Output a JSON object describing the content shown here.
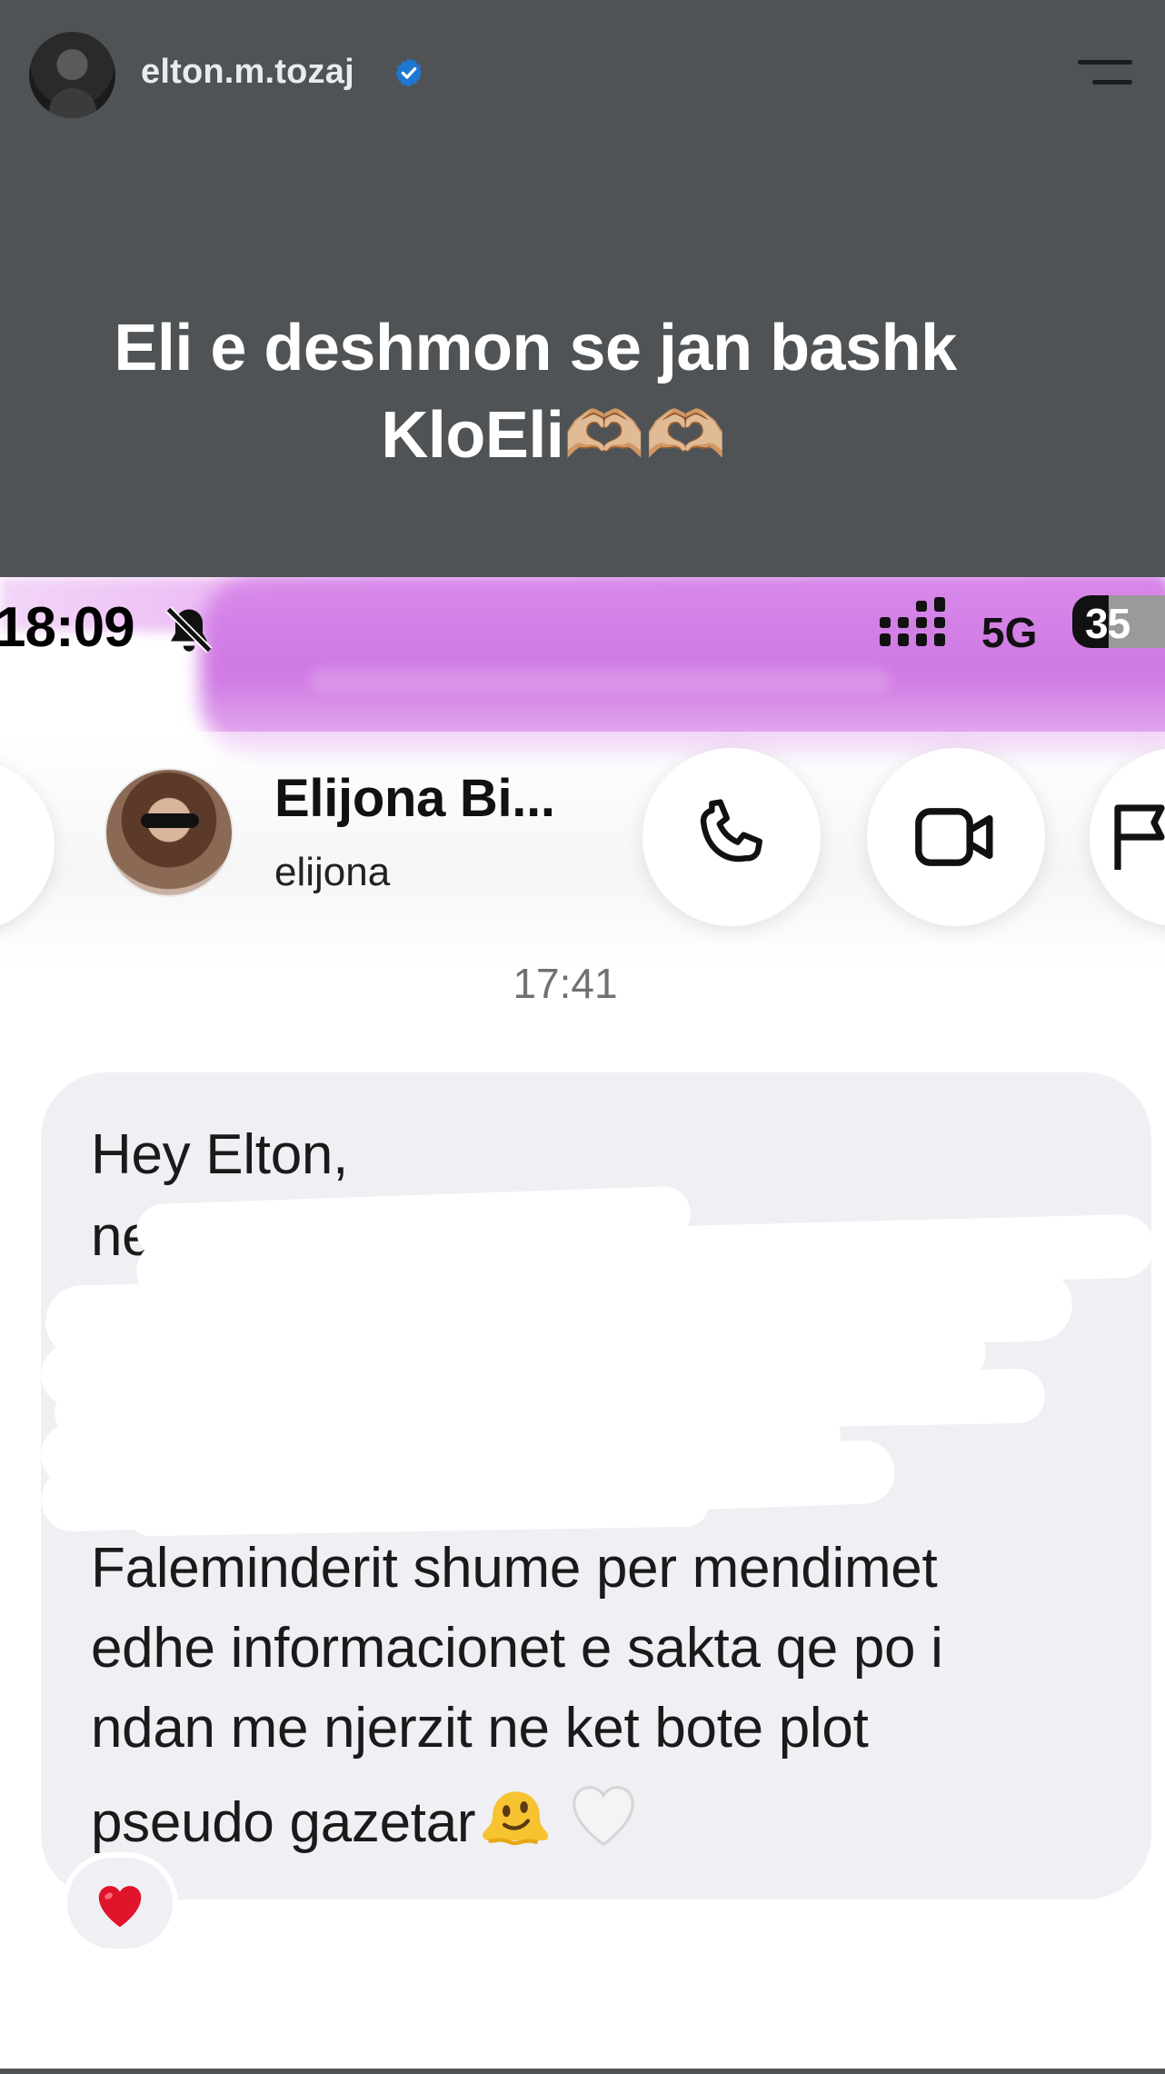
{
  "story": {
    "username": "elton.m.tozaj",
    "caption_line1": "Eli e deshmon se jan bashk",
    "caption_line2": "KloEli🫶🏼🫶🏼"
  },
  "screenshot": {
    "status_bar": {
      "time": "18:09",
      "network": "5G",
      "battery": "35"
    },
    "chat_header": {
      "name": "Elijona Bi...",
      "handle": "elijona"
    },
    "message": {
      "timestamp": "17:41",
      "greeting": "Hey Elton,",
      "fragment": "ne f",
      "body_line1": "Faleminderit shume per mendimet",
      "body_line2": "edhe informacionet e sakta qe po i",
      "body_line3": "ndan me njerzit ne ket bote plot",
      "body_line4": "pseudo gazetar",
      "reaction": "❤️"
    }
  },
  "colors": {
    "story_bg": "#4f5356",
    "bubble_bg": "#efeff4",
    "verified_blue": "#0095f6",
    "accent_purple": "#d67ae7",
    "heart_red": "#e0142a"
  },
  "icons": [
    "verified-badge-icon",
    "menu-icon",
    "bell-off-icon",
    "signal-icon",
    "battery-icon",
    "phone-icon",
    "video-camera-icon",
    "flag-icon",
    "melting-face-emoji",
    "white-heart-emoji",
    "red-heart-icon"
  ]
}
